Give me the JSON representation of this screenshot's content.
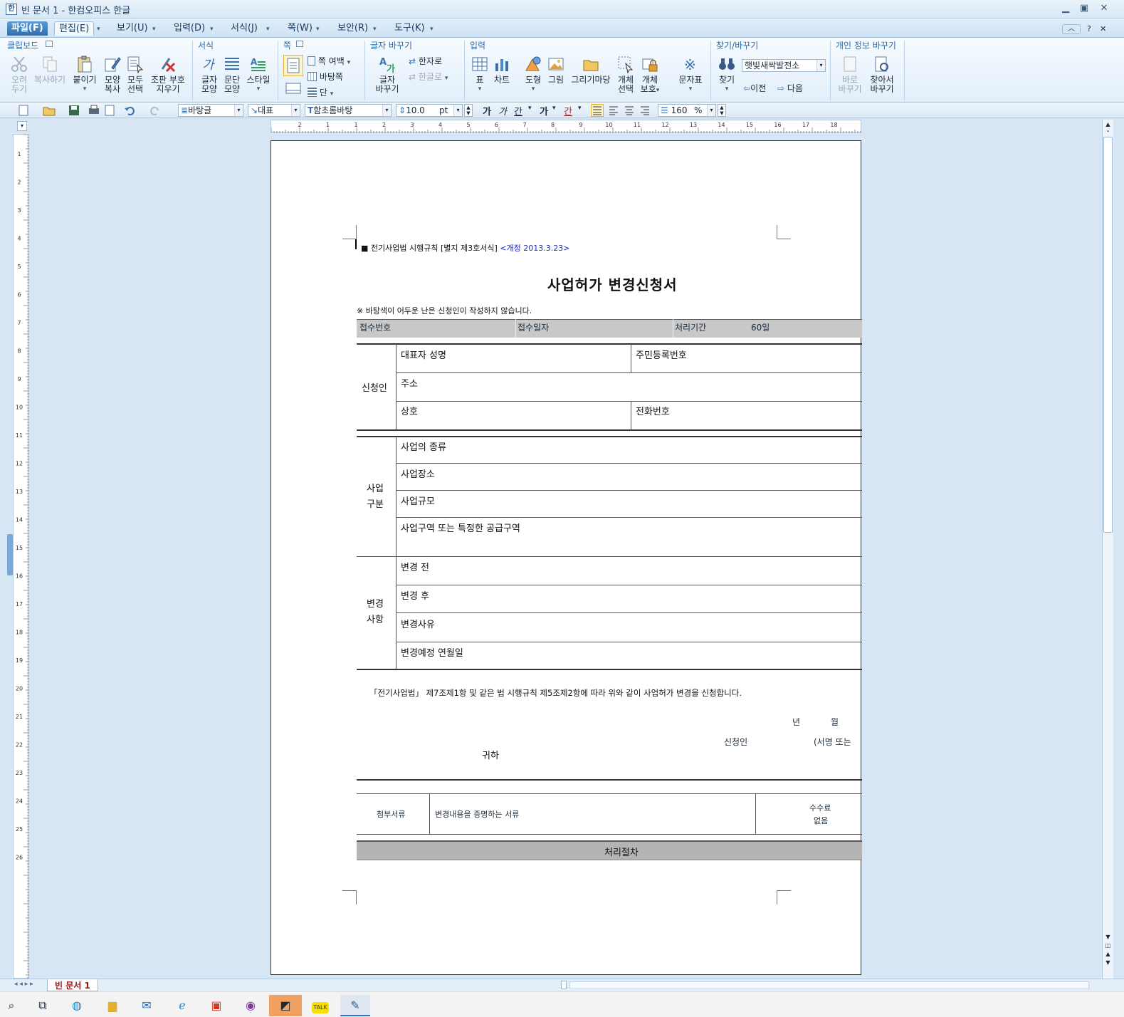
{
  "window": {
    "title": "빈 문서 1 - 한컴오피스 한글",
    "app_icon": "hwp-icon"
  },
  "menu": [
    "파일(F)",
    "편집(E)",
    "보기(U)",
    "입력(D)",
    "서식(J)",
    "쪽(W)",
    "보안(R)",
    "도구(K)"
  ],
  "ribbon": {
    "groups": {
      "clipboard": "클립보드",
      "format": "서식",
      "page": "쪽",
      "char_change": "글자 바꾸기",
      "input": "입력",
      "find": "찾기/바꾸기",
      "privacy": "개인 정보 바꾸기"
    },
    "cut": [
      "오려",
      "두기"
    ],
    "copy": "복사하기",
    "paste": "붙이기",
    "shape_copy": [
      "모양",
      "복사"
    ],
    "select_all": [
      "모두",
      "선택"
    ],
    "clear_codes": [
      "조판 부호",
      "지우기"
    ],
    "char_shape": [
      "글자",
      "모양"
    ],
    "para_shape": [
      "문단",
      "모양"
    ],
    "style": "스타일",
    "page_margin": "쪽 여백",
    "background_page": "바탕쪽",
    "columns": "단",
    "char_change": [
      "글자",
      "바꾸기"
    ],
    "to_hanja": "한자로",
    "to_hangul": "한글로",
    "table": "표",
    "chart": "차트",
    "shape": "도형",
    "picture": "그림",
    "draw_madang": "그리기마당",
    "obj_select": [
      "개체",
      "선택"
    ],
    "obj_protect": [
      "개체",
      "보호"
    ],
    "symbols": "문자표",
    "find": "찾기",
    "find_font": "햇빛새싹발전소",
    "prev": "이전",
    "next": "다음",
    "direct_replace": [
      "바로",
      "바꾸기"
    ],
    "find_replace": [
      "찾아서",
      "바꾸기"
    ]
  },
  "toolbar": {
    "style": "바탕글",
    "outline": "대표",
    "font": "함초롬바탕",
    "size": "10.0",
    "unit": "pt",
    "bold": "가",
    "italic": "가",
    "underline": "간",
    "strike": "가",
    "color": "간",
    "zoom": "160",
    "zoom_unit": "%"
  },
  "ruler": {
    "top_numbers": [
      "2",
      "1",
      "1",
      "2",
      "3",
      "4",
      "5",
      "6",
      "7",
      "8",
      "9",
      "10",
      "11",
      "12",
      "13",
      "14",
      "15",
      "16",
      "17",
      "18"
    ],
    "left_numbers": [
      "1",
      "2",
      "3",
      "4",
      "5",
      "6",
      "7",
      "8",
      "9",
      "10",
      "11",
      "12",
      "13",
      "14",
      "15",
      "16",
      "17",
      "18",
      "19",
      "20",
      "21",
      "22",
      "23",
      "24",
      "25",
      "26"
    ]
  },
  "doc": {
    "header_prefix": "■ 전기사업법 시행규칙 [별지 제3호서식]",
    "header_rev": "<개정 2013.3.23>",
    "title": "사업허가 변경신청서",
    "note": "※ 바탕색이 어두운 난은 신청인이 작성하지 않습니다.",
    "receipt_no": "접수번호",
    "receipt_date": "접수일자",
    "proc_period": "처리기간",
    "proc_days": "60일",
    "applicant": "신청인",
    "rep_name": "대표자 성명",
    "reg_no": "주민등록번호",
    "address": "주소",
    "trade_name": "상호",
    "phone": "전화번호",
    "biz_section": [
      "사업",
      "구분"
    ],
    "biz_type": "사업의 종류",
    "biz_place": "사업장소",
    "biz_scale": "사업규모",
    "biz_area": "사업구역 또는 특정한 공급구역",
    "change_section": [
      "변경",
      "사항"
    ],
    "before": "변경 전",
    "after": "변경 후",
    "reason": "변경사유",
    "planned_date": "변경예정 연월일",
    "statement": "「전기사업법」 제7조제1항 및 같은 법 시행규칙 제5조제2항에 따라 위와 같이 사업허가 변경을 신청합니다.",
    "year": "년",
    "month": "월",
    "sign_applicant": "신청인",
    "sign_note": "(서명 또는",
    "addressee": "귀하",
    "attachments": "첨부서류",
    "attach_desc": "변경내용을 증명하는 서류",
    "fee": "수수료",
    "fee_val": "없음",
    "procedure": "처리절차"
  },
  "status": {
    "tab": "빈 문서 1"
  }
}
